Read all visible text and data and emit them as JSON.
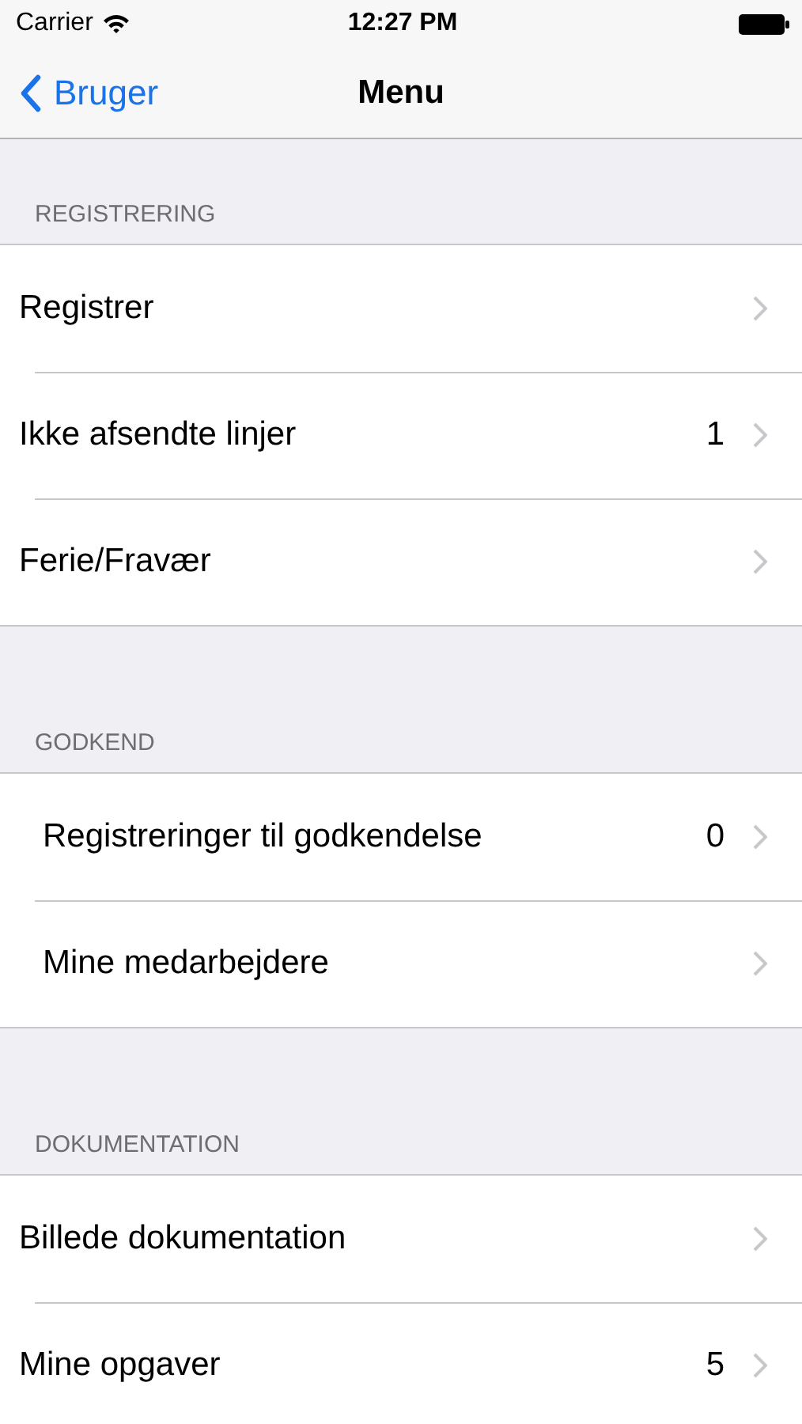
{
  "status_bar": {
    "carrier": "Carrier",
    "time": "12:27 PM"
  },
  "nav_bar": {
    "back": "Bruger",
    "title": "Menu"
  },
  "sections": [
    {
      "header": "REGISTRERING",
      "indented": false,
      "rows": [
        {
          "label": "Registrer"
        },
        {
          "label": "Ikke afsendte linjer",
          "count": "1"
        },
        {
          "label": "Ferie/Fravær"
        }
      ]
    },
    {
      "header": "GODKEND",
      "indented": true,
      "rows": [
        {
          "label": "Registreringer til godkendelse",
          "count": "0"
        },
        {
          "label": "Mine medarbejdere"
        }
      ]
    },
    {
      "header": "DOKUMENTATION",
      "indented": false,
      "rows": [
        {
          "label": "Billede dokumentation"
        },
        {
          "label": "Mine opgaver",
          "count": "5"
        }
      ]
    }
  ]
}
